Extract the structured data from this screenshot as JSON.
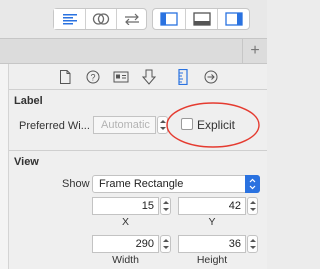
{
  "toolbar": {
    "icons": [
      "align-left-icon",
      "link-circles-icon",
      "swap-arrows-icon",
      "panel-left-icon",
      "panel-bottom-icon",
      "panel-right-icon"
    ]
  },
  "tabbar": {
    "plus": "+"
  },
  "inspector": {
    "label_section": {
      "title": "Label",
      "preferred_width_label": "Preferred Wi...",
      "preferred_width_placeholder": "Automatic",
      "explicit_label": "Explicit"
    },
    "view_section": {
      "title": "View",
      "show_label": "Show",
      "show_value": "Frame Rectangle",
      "x_value": "15",
      "x_label": "X",
      "y_value": "42",
      "y_label": "Y",
      "width_value": "290",
      "width_label": "Width",
      "height_value": "36",
      "height_label": "Height"
    }
  },
  "annotation": {
    "color": "#e53b30"
  }
}
